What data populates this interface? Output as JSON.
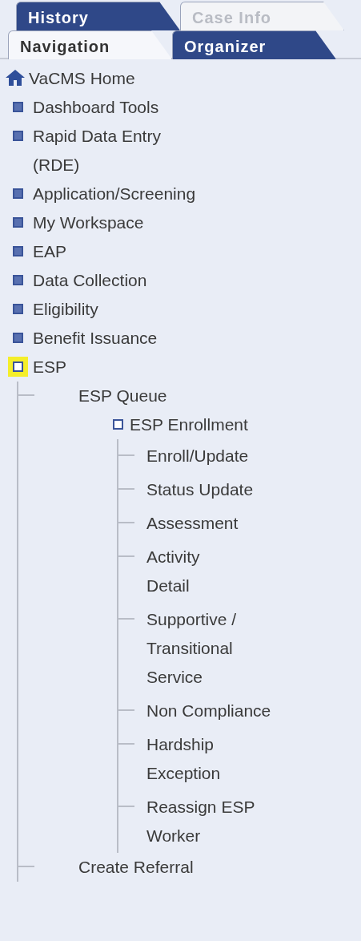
{
  "tab_rows": [
    [
      {
        "label": "History",
        "selected": false,
        "disabled": false
      },
      {
        "label": "Case Info",
        "selected": false,
        "disabled": true
      }
    ],
    [
      {
        "label": "Navigation",
        "selected": true,
        "disabled": false
      },
      {
        "label": "Organizer",
        "selected": false,
        "disabled": false
      }
    ]
  ],
  "tree": [
    {
      "kind": "home",
      "lines": [
        "VaCMS Home"
      ]
    },
    {
      "kind": "folder",
      "lines": [
        "Dashboard Tools"
      ],
      "expanded": false,
      "highlighted": false
    },
    {
      "kind": "folder",
      "lines": [
        "Rapid Data Entry",
        "(RDE)"
      ],
      "expanded": false,
      "highlighted": false
    },
    {
      "kind": "folder",
      "lines": [
        "Application/Screening"
      ],
      "expanded": false,
      "highlighted": false
    },
    {
      "kind": "folder",
      "lines": [
        "My Workspace"
      ],
      "expanded": false,
      "highlighted": false
    },
    {
      "kind": "folder",
      "lines": [
        "EAP"
      ],
      "expanded": false,
      "highlighted": false
    },
    {
      "kind": "folder",
      "lines": [
        "Data Collection"
      ],
      "expanded": false,
      "highlighted": false
    },
    {
      "kind": "folder",
      "lines": [
        "Eligibility"
      ],
      "expanded": false,
      "highlighted": false
    },
    {
      "kind": "folder",
      "lines": [
        "Benefit Issuance"
      ],
      "expanded": false,
      "highlighted": false
    },
    {
      "kind": "folder",
      "lines": [
        "ESP"
      ],
      "expanded": true,
      "highlighted": true,
      "children": [
        {
          "kind": "leaf",
          "lines": [
            "ESP Queue"
          ]
        },
        {
          "kind": "folder",
          "lines": [
            "ESP Enrollment"
          ],
          "expanded": true,
          "highlighted": false,
          "children": [
            {
              "kind": "leaf",
              "lines": [
                "Enroll/Update"
              ]
            },
            {
              "kind": "leaf",
              "lines": [
                "Status Update"
              ]
            },
            {
              "kind": "leaf",
              "lines": [
                "Assessment"
              ]
            },
            {
              "kind": "leaf",
              "lines": [
                "Activity",
                "Detail"
              ]
            },
            {
              "kind": "leaf",
              "lines": [
                "Supportive /",
                "Transitional",
                "Service"
              ]
            },
            {
              "kind": "leaf",
              "lines": [
                "Non Compliance"
              ]
            },
            {
              "kind": "leaf",
              "lines": [
                "Hardship",
                "Exception"
              ]
            },
            {
              "kind": "leaf",
              "lines": [
                "Reassign ESP",
                "Worker"
              ]
            }
          ]
        },
        {
          "kind": "leaf",
          "lines": [
            "Create Referral"
          ]
        }
      ]
    }
  ]
}
